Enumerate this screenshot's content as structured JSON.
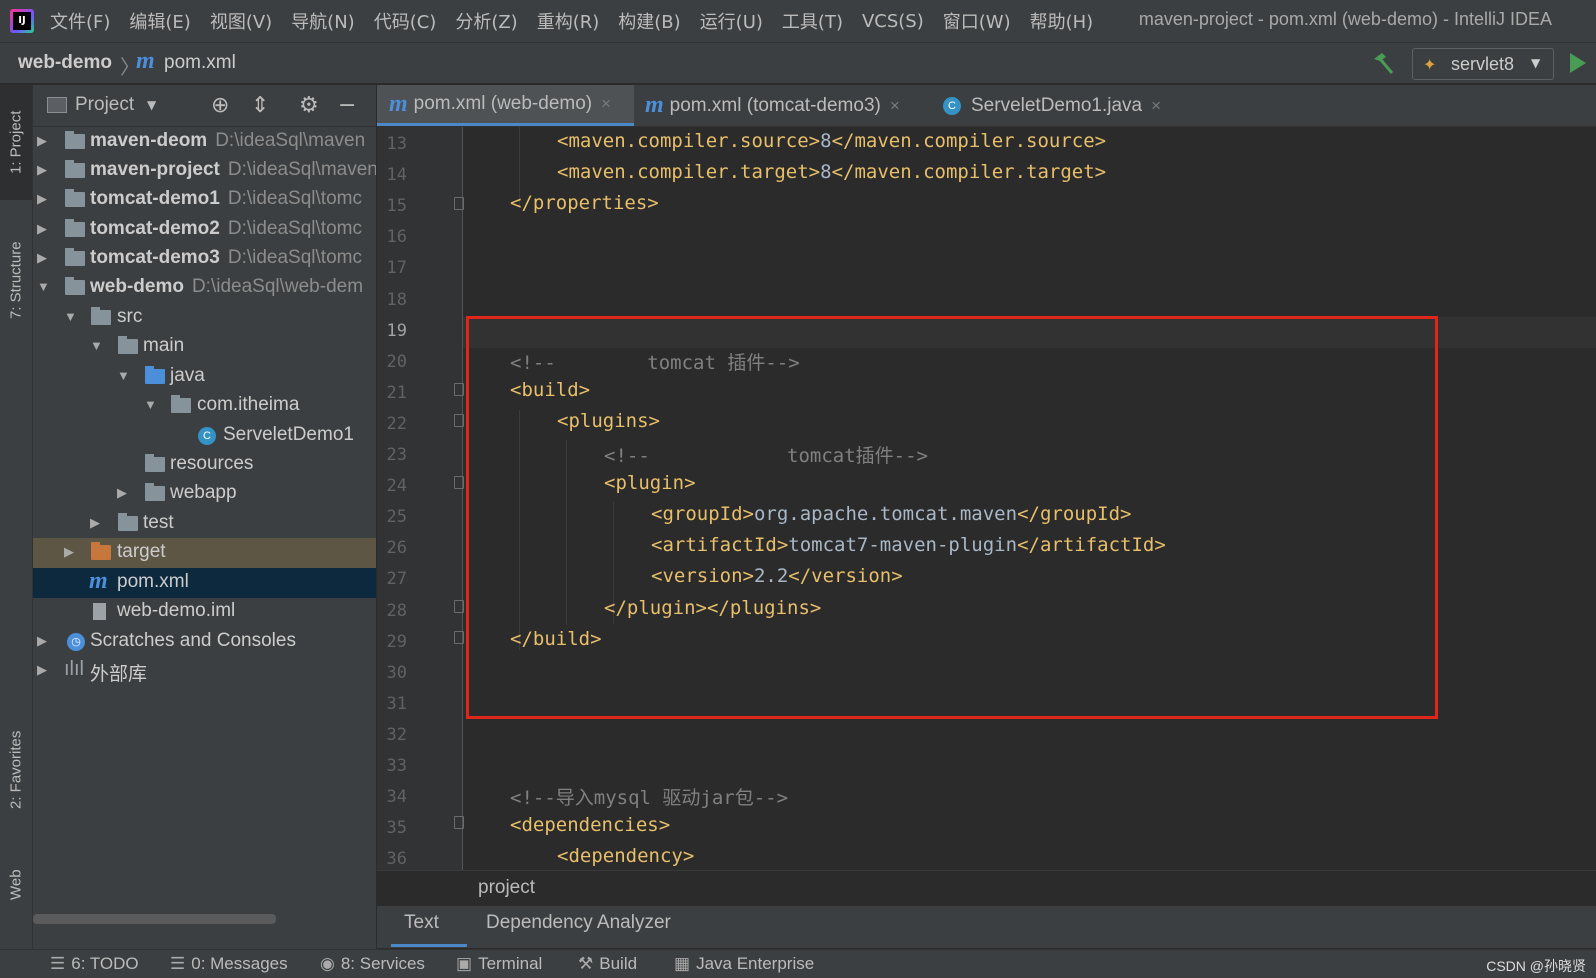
{
  "menu": [
    "文件(F)",
    "编辑(E)",
    "视图(V)",
    "导航(N)",
    "代码(C)",
    "分析(Z)",
    "重构(R)",
    "构建(B)",
    "运行(U)",
    "工具(T)",
    "VCS(S)",
    "窗口(W)",
    "帮助(H)"
  ],
  "window_title": "maven-project - pom.xml (web-demo) - IntelliJ IDEA",
  "breadcrumb": {
    "project": "web-demo",
    "sep": "〉",
    "file_icon": "m",
    "file": "pom.xml"
  },
  "run_config": {
    "label": "servlet8",
    "icon": "tomcat-icon"
  },
  "left_strip": {
    "project": "1: Project",
    "structure": "7: Structure",
    "favorites": "2: Favorites",
    "web": "Web"
  },
  "project_panel": {
    "title": "Project",
    "tree": [
      {
        "name": "maven-deom",
        "path": "D:\\ideaSql\\maven",
        "bold": true
      },
      {
        "name": "maven-project",
        "path": "D:\\ideaSql\\maven",
        "bold": true
      },
      {
        "name": "tomcat-demo1",
        "path": "D:\\ideaSql\\tomc",
        "bold": true
      },
      {
        "name": "tomcat-demo2",
        "path": "D:\\ideaSql\\tomc",
        "bold": true
      },
      {
        "name": "tomcat-demo3",
        "path": "D:\\ideaSql\\tomc",
        "bold": true
      },
      {
        "name": "web-demo",
        "path": "D:\\ideaSql\\web-dem",
        "bold": true
      },
      {
        "name": "src"
      },
      {
        "name": "main"
      },
      {
        "name": "java"
      },
      {
        "name": "com.itheima"
      },
      {
        "name": "ServeletDemo1"
      },
      {
        "name": "resources"
      },
      {
        "name": "webapp"
      },
      {
        "name": "test"
      },
      {
        "name": "target"
      },
      {
        "name": "pom.xml"
      },
      {
        "name": "web-demo.iml"
      },
      {
        "name": "Scratches and Consoles"
      },
      {
        "name": "外部库"
      }
    ]
  },
  "tabs": [
    {
      "label": "pom.xml (web-demo)",
      "icon": "m",
      "close": "×"
    },
    {
      "label": "pom.xml (tomcat-demo3)",
      "icon": "m",
      "close": "×"
    },
    {
      "label": "ServeletDemo1.java",
      "icon": "C",
      "close": "×"
    }
  ],
  "editor": {
    "lines": [
      {
        "n": "13",
        "parts": [
          [
            "tag",
            "<maven.compiler.source>"
          ],
          [
            "txt",
            "8"
          ],
          [
            "tag",
            "</maven.compiler.source>"
          ]
        ]
      },
      {
        "n": "14",
        "parts": [
          [
            "tag",
            "<maven.compiler.target>"
          ],
          [
            "txt",
            "8"
          ],
          [
            "tag",
            "</maven.compiler.target>"
          ]
        ]
      },
      {
        "n": "15",
        "parts": [
          [
            "tag",
            "</properties>"
          ]
        ]
      },
      {
        "n": "16",
        "parts": []
      },
      {
        "n": "17",
        "parts": []
      },
      {
        "n": "18",
        "parts": []
      },
      {
        "n": "19",
        "parts": []
      },
      {
        "n": "20",
        "parts": [
          [
            "cmt",
            "<!--        tomcat 插件-->"
          ]
        ]
      },
      {
        "n": "21",
        "parts": [
          [
            "tag",
            "<build>"
          ]
        ]
      },
      {
        "n": "22",
        "parts": [
          [
            "tag",
            "<plugins>"
          ]
        ]
      },
      {
        "n": "23",
        "parts": [
          [
            "cmt",
            "<!--            tomcat插件-->"
          ]
        ]
      },
      {
        "n": "24",
        "parts": [
          [
            "tag",
            "<plugin>"
          ]
        ]
      },
      {
        "n": "25",
        "parts": [
          [
            "tag",
            "<groupId>"
          ],
          [
            "txt",
            "org.apache.tomcat.maven"
          ],
          [
            "tag",
            "</groupId>"
          ]
        ]
      },
      {
        "n": "26",
        "parts": [
          [
            "tag",
            "<artifactId>"
          ],
          [
            "txt",
            "tomcat7-maven-plugin"
          ],
          [
            "tag",
            "</artifactId>"
          ]
        ]
      },
      {
        "n": "27",
        "parts": [
          [
            "tag",
            "<version>"
          ],
          [
            "txt",
            "2.2"
          ],
          [
            "tag",
            "</version>"
          ]
        ]
      },
      {
        "n": "28",
        "parts": [
          [
            "tag",
            "</plugin></plugins>"
          ]
        ]
      },
      {
        "n": "29",
        "parts": [
          [
            "tag",
            "</build>"
          ]
        ]
      },
      {
        "n": "30",
        "parts": []
      },
      {
        "n": "31",
        "parts": []
      },
      {
        "n": "32",
        "parts": []
      },
      {
        "n": "33",
        "parts": []
      },
      {
        "n": "34",
        "parts": [
          [
            "cmt",
            "<!--导入mysql 驱动jar包-->"
          ]
        ]
      },
      {
        "n": "35",
        "parts": [
          [
            "tag",
            "<dependencies>"
          ]
        ]
      },
      {
        "n": "36",
        "parts": [
          [
            "tag",
            "<dependency>"
          ]
        ]
      }
    ],
    "current_line": "19"
  },
  "editor_breadcrumb": "project",
  "editor_subtabs": [
    "Text",
    "Dependency Analyzer"
  ],
  "bottom_tools": [
    {
      "label": "6: TODO",
      "icon": "todo-icon"
    },
    {
      "label": "0: Messages",
      "icon": "messages-icon"
    },
    {
      "label": "8: Services",
      "icon": "services-icon"
    },
    {
      "label": "Terminal",
      "icon": "terminal-icon"
    },
    {
      "label": "Build",
      "icon": "hammer-icon"
    },
    {
      "label": "Java Enterprise",
      "icon": "java-enterprise-icon"
    }
  ],
  "watermark": "CSDN @孙晓贤",
  "colors": {
    "accent": "#4a88c7",
    "highlight_box": "#e0261b",
    "tag": "#e8bf6a",
    "comment": "#808080",
    "text": "#a9b7c6"
  }
}
